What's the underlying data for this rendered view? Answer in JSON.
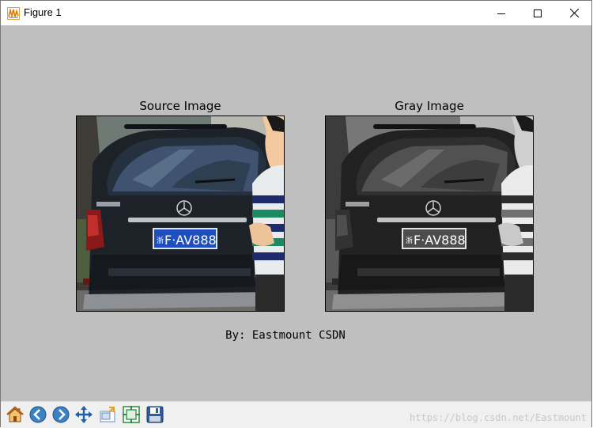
{
  "window": {
    "title": "Figure 1",
    "app_icon": "matplotlib-figure-icon",
    "controls": [
      "minimize-icon",
      "maximize-icon",
      "close-icon"
    ]
  },
  "figure": {
    "background": "#bfbfbf",
    "axes": [
      {
        "title": "Source Image",
        "plate_text": "F·AV888",
        "plate_prefix": "浙",
        "grayscale": false
      },
      {
        "title": "Gray Image",
        "plate_text": "F·AV888",
        "plate_prefix": "浙",
        "grayscale": true
      }
    ],
    "footer": "By: Eastmount CSDN"
  },
  "toolbar": {
    "buttons": [
      {
        "icon": "home-icon"
      },
      {
        "icon": "back-arrow-icon"
      },
      {
        "icon": "forward-arrow-icon"
      },
      {
        "icon": "pan-move-icon"
      },
      {
        "icon": "zoom-rect-icon"
      },
      {
        "icon": "configure-subplots-icon"
      },
      {
        "icon": "save-icon"
      }
    ]
  },
  "watermark": "https://blog.csdn.net/Eastmount"
}
